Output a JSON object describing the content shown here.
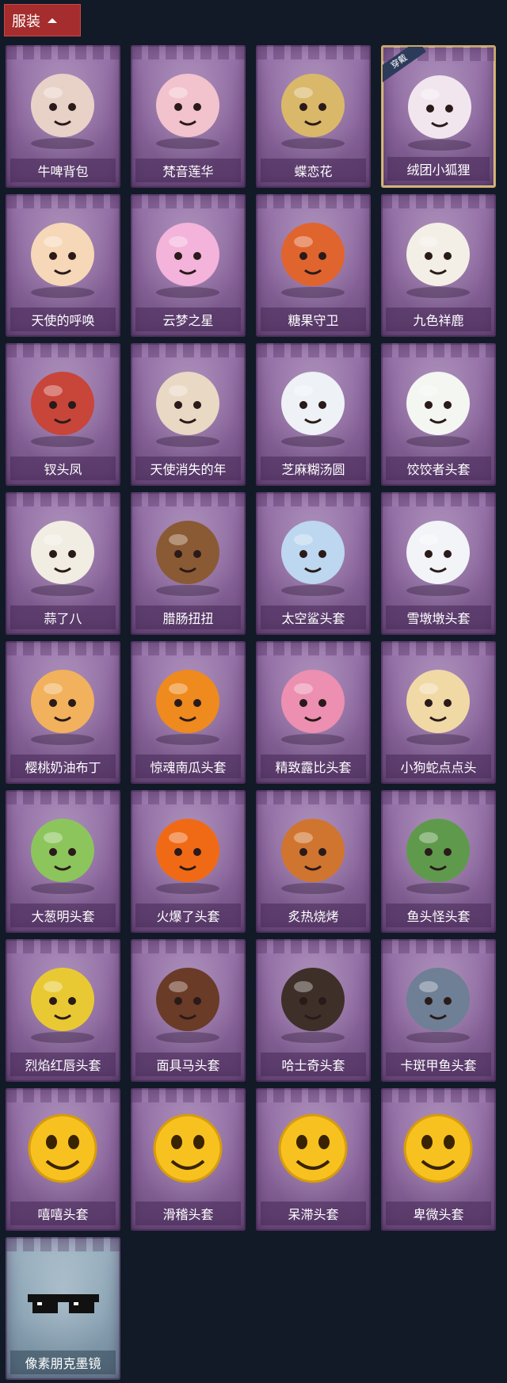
{
  "header": {
    "title": "服装",
    "toggle_icon": "chevron-up-icon"
  },
  "items": [
    {
      "label": "牛啤背包",
      "icon": "cow-beer-backpack-icon",
      "accent": "#e8d2c8"
    },
    {
      "label": "梵音莲华",
      "icon": "lotus-fairy-icon",
      "accent": "#f2c3cc"
    },
    {
      "label": "蝶恋花",
      "icon": "butterfly-flower-ornament-icon",
      "accent": "#d9b86a"
    },
    {
      "label": "绒团小狐狸",
      "icon": "fluffy-fox-icon",
      "accent": "#f1e6ee",
      "badge": "穿戴"
    },
    {
      "label": "天使的呼唤",
      "icon": "angel-doll-icon",
      "accent": "#f6d7b7"
    },
    {
      "label": "云梦之星",
      "icon": "unicorn-cloud-icon",
      "accent": "#f3b3da"
    },
    {
      "label": "糖果守卫",
      "icon": "pumpkin-scarecrow-icon",
      "accent": "#e0642e"
    },
    {
      "label": "九色祥鹿",
      "icon": "deer-ornament-icon",
      "accent": "#f3efe6"
    },
    {
      "label": "钗头凤",
      "icon": "phoenix-crown-doll-icon",
      "accent": "#c8453a"
    },
    {
      "label": "天使消失的年",
      "icon": "angel-halo-doll-icon",
      "accent": "#e9d8c4"
    },
    {
      "label": "芝麻糊汤圆",
      "icon": "rice-ball-head-icon",
      "accent": "#eef1f6"
    },
    {
      "label": "饺饺者头套",
      "icon": "dumpling-head-icon",
      "accent": "#f4f6f2"
    },
    {
      "label": "蒜了八",
      "icon": "garlic-head-icon",
      "accent": "#f1ede2"
    },
    {
      "label": "腊肠扭扭",
      "icon": "dachshund-head-icon",
      "accent": "#8a5a34"
    },
    {
      "label": "太空鲨头套",
      "icon": "shark-head-icon",
      "accent": "#bcd7ef"
    },
    {
      "label": "雪墩墩头套",
      "icon": "snowman-head-icon",
      "accent": "#f2f4f7"
    },
    {
      "label": "樱桃奶油布丁",
      "icon": "pudding-head-icon",
      "accent": "#f2b15d"
    },
    {
      "label": "惊魂南瓜头套",
      "icon": "pumpkin-head-icon",
      "accent": "#ee8a1e"
    },
    {
      "label": "精致露比头套",
      "icon": "pink-beaver-head-icon",
      "accent": "#ec8fb0"
    },
    {
      "label": "小狗蛇点点头",
      "icon": "snake-dog-head-icon",
      "accent": "#f1d9a6"
    },
    {
      "label": "大葱明头套",
      "icon": "scallion-head-icon",
      "accent": "#8cc55c"
    },
    {
      "label": "火爆了头套",
      "icon": "fire-head-icon",
      "accent": "#f06a16"
    },
    {
      "label": "炙热烧烤",
      "icon": "bbq-meat-head-icon",
      "accent": "#d0752f"
    },
    {
      "label": "鱼头怪头套",
      "icon": "fish-head-icon",
      "accent": "#5f9a4c"
    },
    {
      "label": "烈焰红唇头套",
      "icon": "yellow-mascot-head-icon",
      "accent": "#e9c933"
    },
    {
      "label": "面具马头套",
      "icon": "horse-mask-icon",
      "accent": "#6a3b27"
    },
    {
      "label": "哈士奇头套",
      "icon": "shepherd-dog-head-icon",
      "accent": "#3e2f28"
    },
    {
      "label": "卡斑甲鱼头套",
      "icon": "turtle-head-icon",
      "accent": "#6f7f95"
    },
    {
      "label": "嘻嘻头套",
      "icon": "grin-emoji-head-icon",
      "accent": "#f7c21f"
    },
    {
      "label": "滑稽头套",
      "icon": "funny-emoji-head-icon",
      "accent": "#f7c21f"
    },
    {
      "label": "呆滞头套",
      "icon": "stunned-emoji-head-icon",
      "accent": "#f7c21f"
    },
    {
      "label": "卑微头套",
      "icon": "humble-emoji-head-icon",
      "accent": "#f7c21f"
    },
    {
      "label": "像素朋克墨镜",
      "icon": "pixel-sunglasses-icon",
      "accent": "#111111",
      "special": true
    }
  ]
}
